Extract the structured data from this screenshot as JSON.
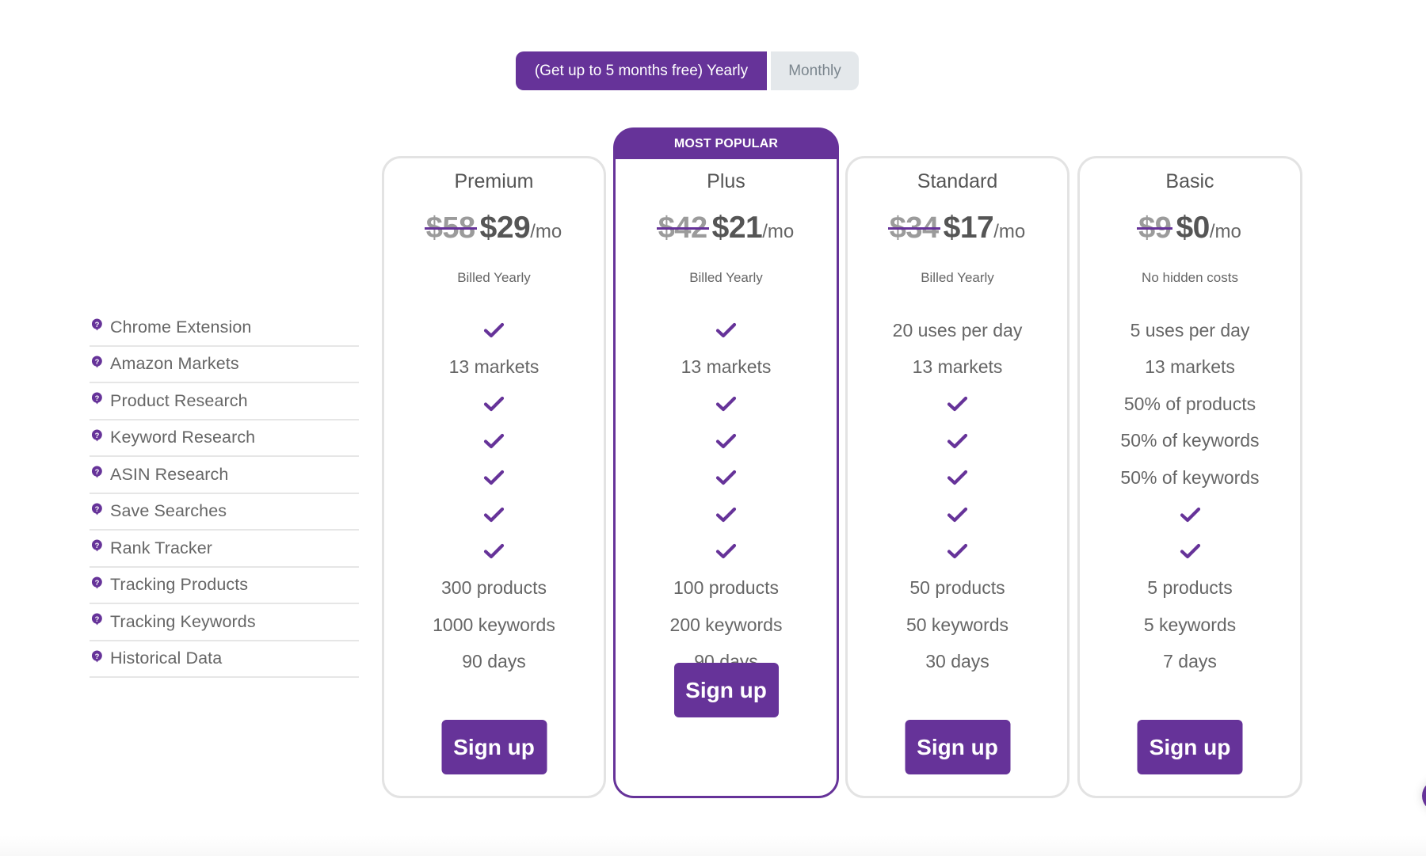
{
  "billing_toggle": {
    "yearly_label": "(Get up to 5 months free) Yearly",
    "monthly_label": "Monthly",
    "selected": "yearly"
  },
  "colors": {
    "brand": "#663399",
    "card_border": "#e3e3e3",
    "toggle_inactive_bg": "#e4e8eb"
  },
  "features": [
    {
      "label": "Chrome Extension",
      "icon": "question-bubble-icon"
    },
    {
      "label": "Amazon Markets",
      "icon": "question-bubble-icon"
    },
    {
      "label": "Product Research",
      "icon": "question-bubble-icon"
    },
    {
      "label": "Keyword Research",
      "icon": "question-bubble-icon"
    },
    {
      "label": "ASIN Research",
      "icon": "question-bubble-icon"
    },
    {
      "label": "Save Searches",
      "icon": "question-bubble-icon"
    },
    {
      "label": "Rank Tracker",
      "icon": "question-bubble-icon"
    },
    {
      "label": "Tracking Products",
      "icon": "question-bubble-icon"
    },
    {
      "label": "Tracking Keywords",
      "icon": "question-bubble-icon"
    },
    {
      "label": "Historical Data",
      "icon": "question-bubble-icon"
    }
  ],
  "plans": [
    {
      "name": "Premium",
      "old_price": "$58",
      "price": "$29",
      "per": "/mo",
      "billing": "Billed Yearly",
      "popular": false,
      "values": [
        "check",
        "13 markets",
        "check",
        "check",
        "check",
        "check",
        "check",
        "300 products",
        "1000 keywords",
        "90 days"
      ],
      "cta": "Sign up"
    },
    {
      "name": "Plus",
      "badge": "MOST POPULAR",
      "old_price": "$42",
      "price": "$21",
      "per": "/mo",
      "billing": "Billed Yearly",
      "popular": true,
      "values": [
        "check",
        "13 markets",
        "check",
        "check",
        "check",
        "check",
        "check",
        "100 products",
        "200 keywords",
        "90 days"
      ],
      "cta": "Sign up"
    },
    {
      "name": "Standard",
      "old_price": "$34",
      "price": "$17",
      "per": "/mo",
      "billing": "Billed Yearly",
      "popular": false,
      "values": [
        "20 uses per day",
        "13 markets",
        "check",
        "check",
        "check",
        "check",
        "check",
        "50 products",
        "50 keywords",
        "30 days"
      ],
      "cta": "Sign up"
    },
    {
      "name": "Basic",
      "old_price": "$9",
      "price": "$0",
      "per": "/mo",
      "billing": "No hidden costs",
      "popular": false,
      "values": [
        "5 uses per day",
        "13 markets",
        "50% of products",
        "50% of keywords",
        "50% of keywords",
        "check",
        "check",
        "5 products",
        "5 keywords",
        "7 days"
      ],
      "cta": "Sign up"
    }
  ]
}
